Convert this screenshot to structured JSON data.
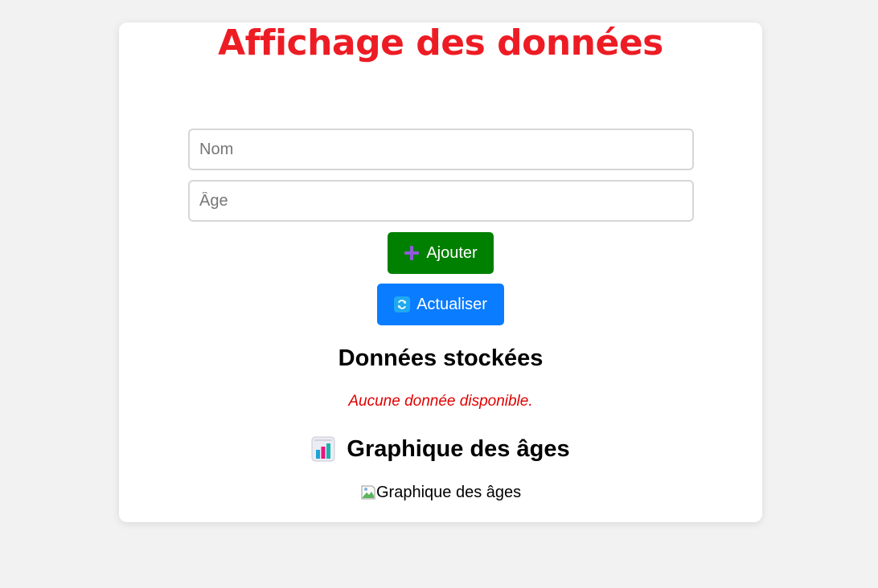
{
  "header": {
    "title": "Affichage des données"
  },
  "form": {
    "name_placeholder": "Nom",
    "age_placeholder": "Âge",
    "name_value": "",
    "age_value": ""
  },
  "buttons": {
    "add_label": "Ajouter",
    "add_icon": "plus-icon",
    "add_color": "#008000",
    "refresh_label": "Actualiser",
    "refresh_icon": "refresh-icon",
    "refresh_color": "#0a7cff"
  },
  "stored": {
    "title": "Données stockées",
    "empty_message": "Aucune donnée disponible.",
    "empty_color": "#e00000"
  },
  "chart": {
    "title": "Graphique des âges",
    "icon": "bar-chart-icon",
    "image_alt": "Graphique des âges",
    "image_icon": "broken-image-icon"
  },
  "colors": {
    "title": "#ed1c24",
    "background": "#f2f2f2",
    "card": "#ffffff"
  }
}
